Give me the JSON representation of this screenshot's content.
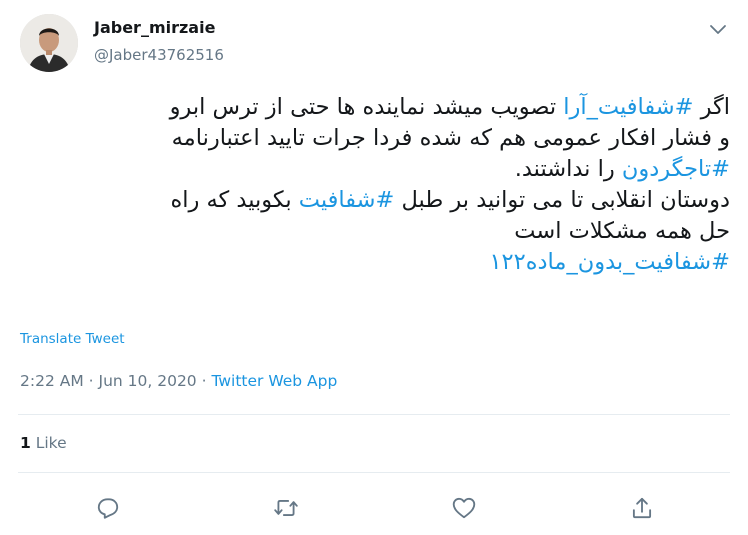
{
  "user": {
    "display_name": "Jaber_mirzaie",
    "handle": "@Jaber43762516"
  },
  "tweet": {
    "line1": [
      "اگر ",
      "#شفافیت_آرا",
      " تصویب میشد نماینده ها حتی از ترس ابرو"
    ],
    "line2": "و فشار افکار عمومی هم که شده فردا جرات تایید اعتبارنامه",
    "line3": [
      "#تاجگردون",
      " را نداشتند."
    ],
    "line4": [
      "دوستان انقلابی تا می توانید بر طبل ",
      "#شفافیت",
      "  بکوبید که راه"
    ],
    "line5": "حل همه مشکلات است",
    "line6": "#شفافیت_بدون_ماده۱۲۲"
  },
  "translate_label": "Translate Tweet",
  "meta": {
    "time": "2:22 AM",
    "separator": " · ",
    "date": "Jun 10, 2020",
    "source": "Twitter Web App"
  },
  "likes": {
    "count": "1",
    "label": " Like"
  },
  "icons": {
    "caret": "chevron-down-icon",
    "reply": "reply-icon",
    "retweet": "retweet-icon",
    "like": "heart-icon",
    "share": "share-icon"
  },
  "colors": {
    "link": "#1b95e0",
    "text": "#14171a",
    "secondary": "#657786",
    "divider": "#e6ecf0"
  }
}
